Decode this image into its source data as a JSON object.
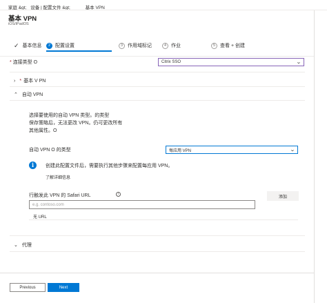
{
  "breadcrumb": [
    "家庭 &gt;",
    "设备 | 配置文件 &gt;",
    "基本 VPN"
  ],
  "header": {
    "title": "基本 VPN",
    "subtitle": "iOS/iPadOS"
  },
  "steps": [
    {
      "num": "✓",
      "label": "基本信息",
      "state": "done"
    },
    {
      "num": "2",
      "label": "配置设置",
      "state": "active"
    },
    {
      "num": "3",
      "label": "作用域标记",
      "state": "pending"
    },
    {
      "num": "4",
      "label": "作业",
      "state": "pending"
    },
    {
      "num": "5",
      "label": "查看 + 创建",
      "state": "pending"
    }
  ],
  "connection_type": {
    "required_mark": "*",
    "label": "连接类型 O",
    "value": "Citrix SSO"
  },
  "sections": {
    "base_vpn": {
      "required_mark": "*",
      "label": "基本 V PN"
    },
    "auto_vpn": {
      "label": "自动 VPN"
    },
    "proxy": {
      "label": "代理"
    }
  },
  "auto_vpn": {
    "description": [
      "选择要使用的自动 VPN 类型。的类型",
      "保存策略后，无法更改 VPN。仍可更改所有",
      "其他属性。O"
    ],
    "type_label": "自动 VPN O 的类型",
    "type_value": "每应用 VPN",
    "info_text": "创建此配置文件后，需要执行其他步骤来配置每应用 VPN。",
    "learn_more": "了解详细信息",
    "safari_label": "行触发此 VPN 的 Safari URL",
    "safari_placeholder": "e.g. contoso.com",
    "add_button": "添加",
    "no_url": "无 URL"
  },
  "footer": {
    "previous": "Previous",
    "next": "Next"
  }
}
